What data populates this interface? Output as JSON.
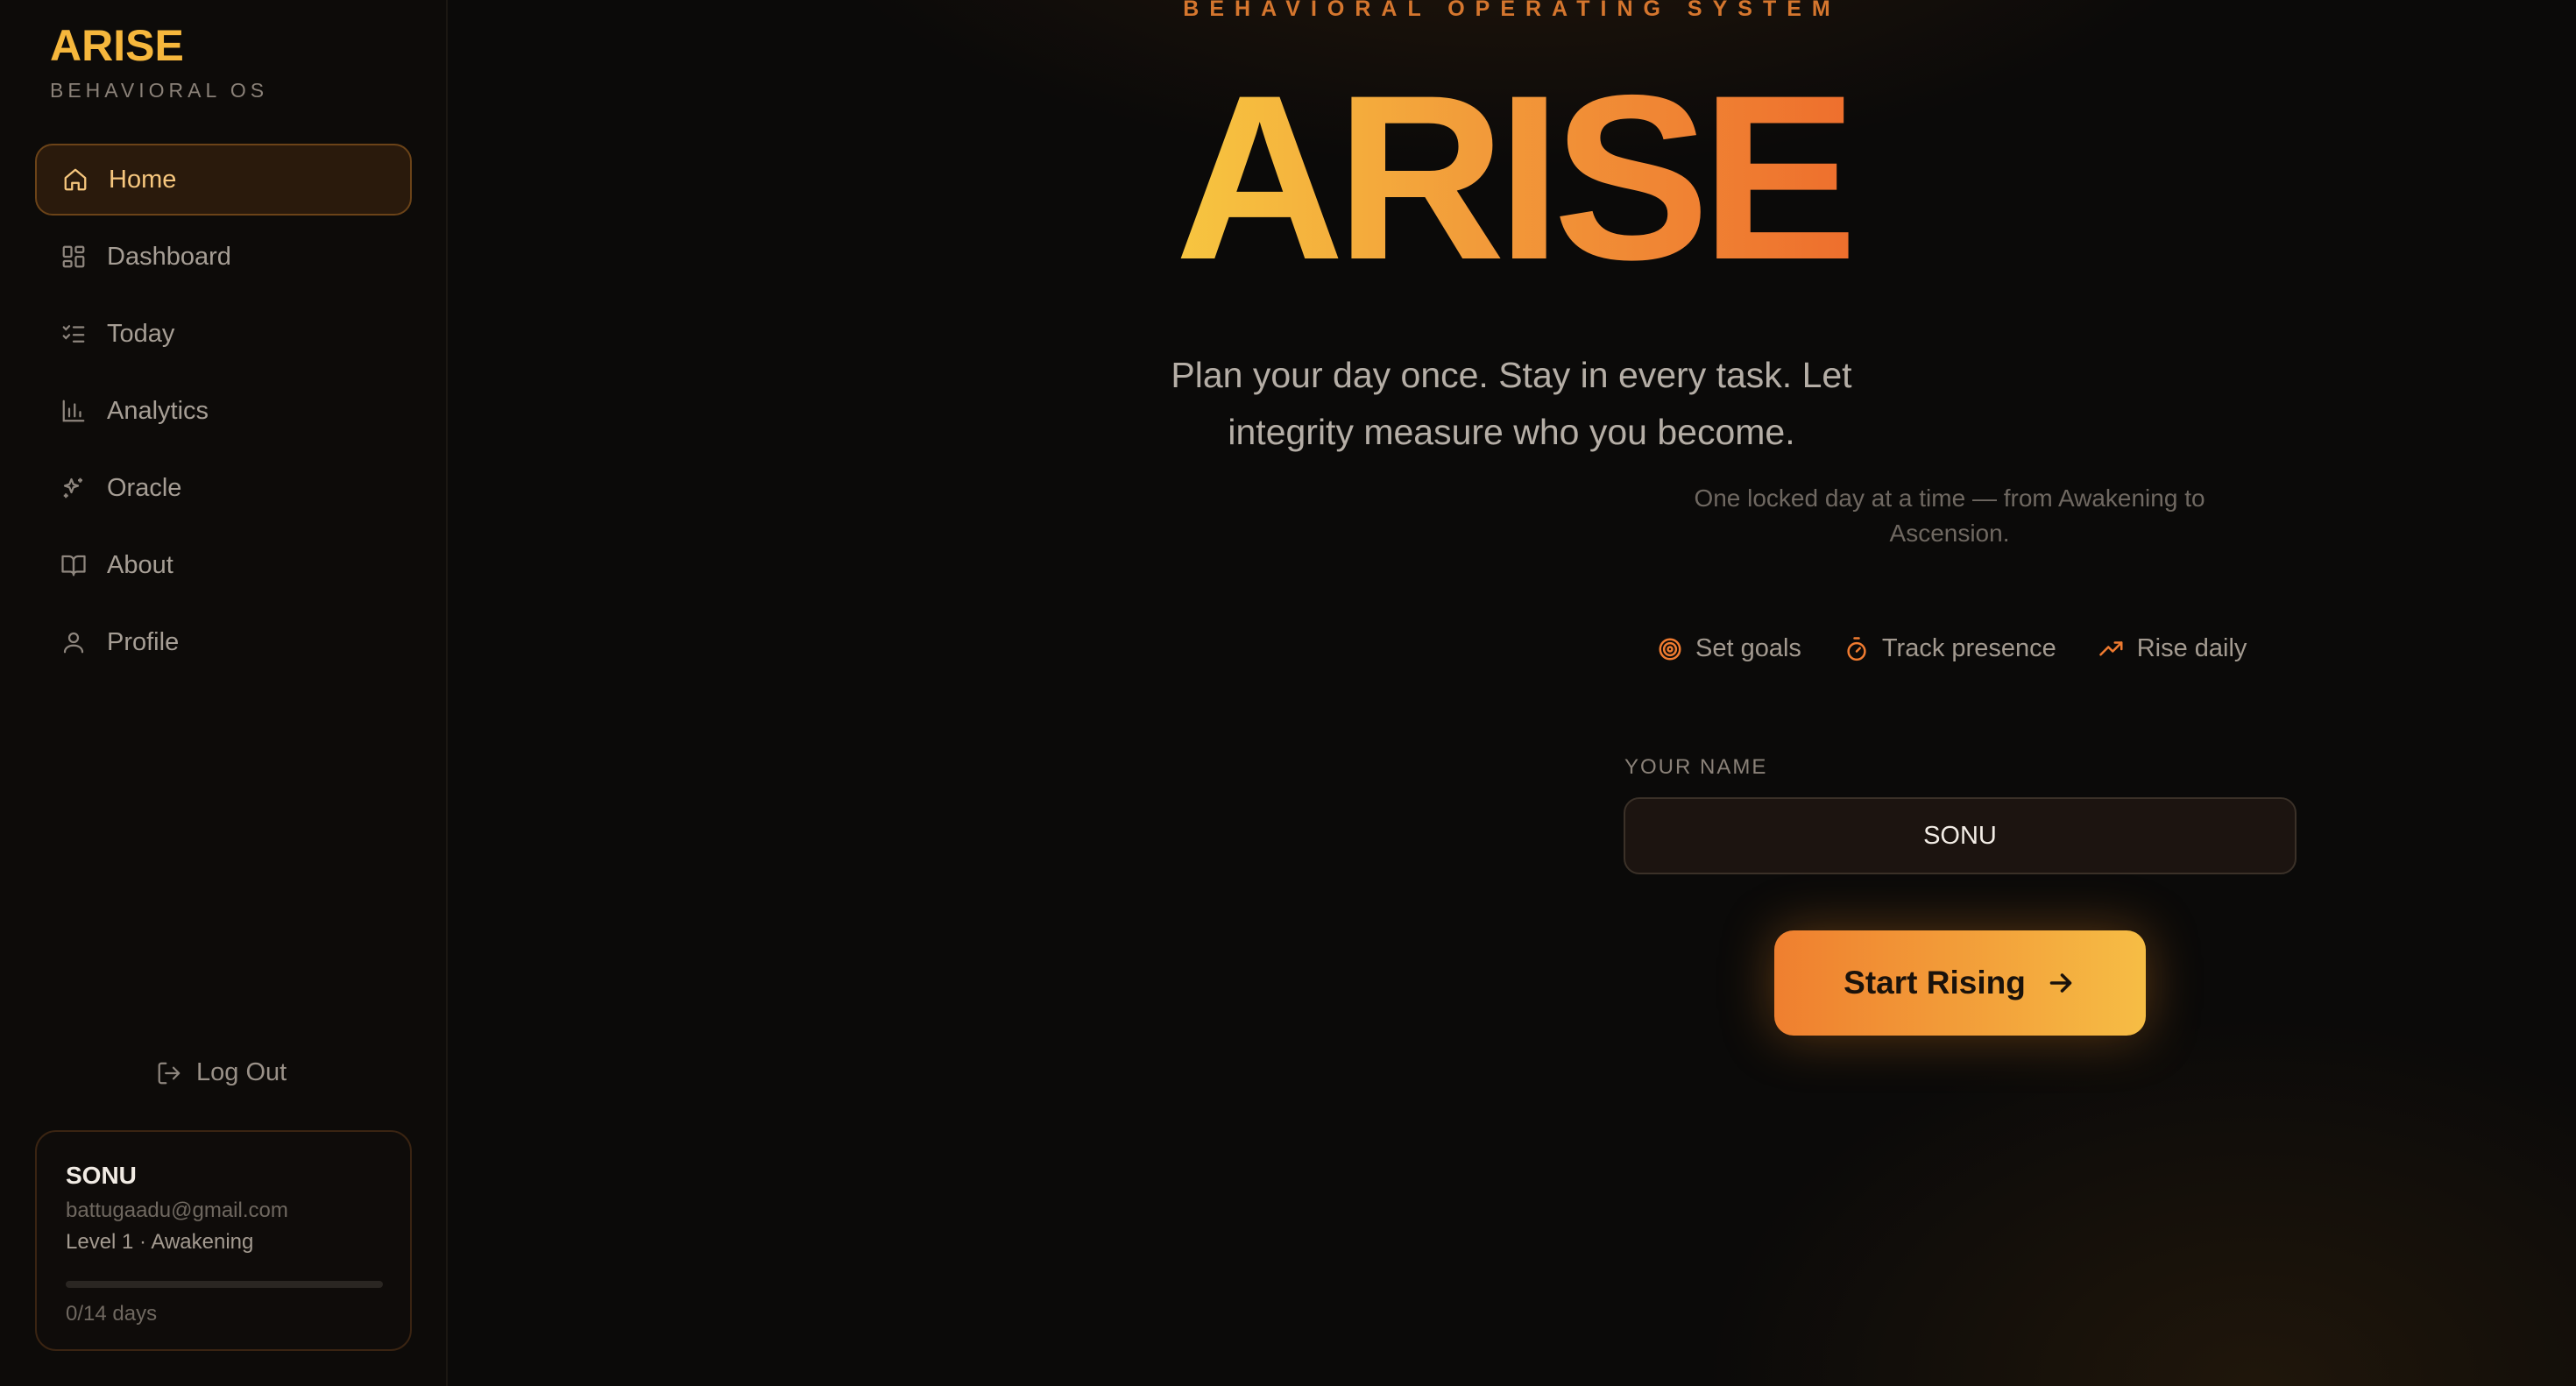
{
  "sidebar": {
    "brand": {
      "title": "ARISE",
      "subtitle": "BEHAVIORAL OS"
    },
    "nav": [
      {
        "label": "Home",
        "icon": "home-icon",
        "active": true
      },
      {
        "label": "Dashboard",
        "icon": "grid-icon"
      },
      {
        "label": "Today",
        "icon": "list-check-icon"
      },
      {
        "label": "Analytics",
        "icon": "bar-chart-icon"
      },
      {
        "label": "Oracle",
        "icon": "sparkles-icon"
      },
      {
        "label": "About",
        "icon": "book-icon"
      },
      {
        "label": "Profile",
        "icon": "user-icon"
      }
    ],
    "logout_label": "Log Out",
    "profile": {
      "name": "SONU",
      "email": "battugaadu@gmail.com",
      "level": "Level 1 · Awakening",
      "progress": 0,
      "days": "0/14 days"
    }
  },
  "main": {
    "kicker": "BEHAVIORAL OPERATING SYSTEM",
    "hero": "ARISE",
    "tagline": "Plan your day once. Stay in every task. Let integrity measure who you become.",
    "subline": "One locked day at a time — from Awakening to Ascension.",
    "features": [
      {
        "label": "Set goals",
        "icon": "target-icon"
      },
      {
        "label": "Track presence",
        "icon": "timer-icon"
      },
      {
        "label": "Rise daily",
        "icon": "trending-up-icon"
      }
    ],
    "name_field": {
      "label": "YOUR NAME",
      "value": "SONU"
    },
    "cta_label": "Start Rising"
  },
  "colors": {
    "accent": "#f6b73c",
    "accent_orange": "#ee6f2d",
    "background": "#0b0a09"
  }
}
